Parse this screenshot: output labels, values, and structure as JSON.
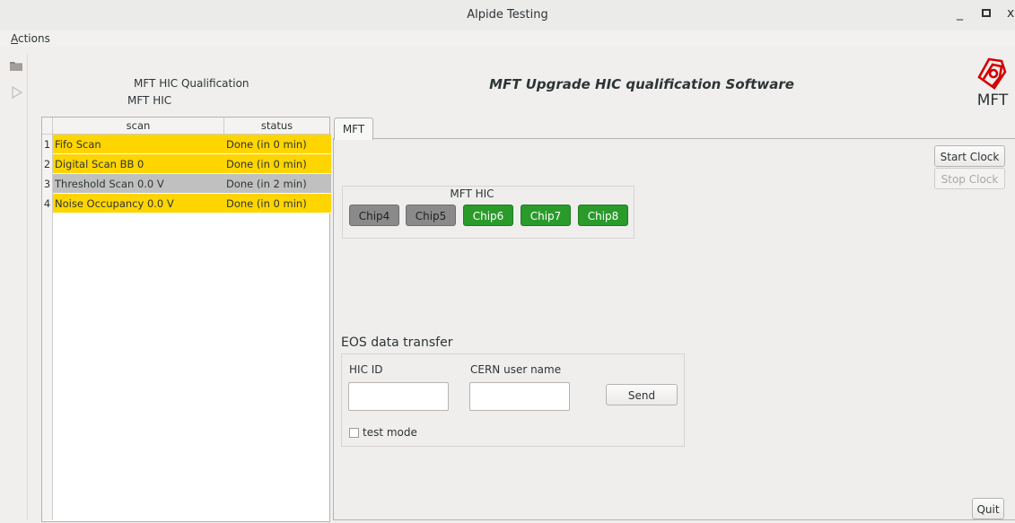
{
  "window": {
    "title": "Alpide Testing",
    "minimize": "_",
    "maximize": "▫",
    "close": "x"
  },
  "menu": {
    "actions_first": "A",
    "actions_rest": "ctions"
  },
  "toolbar": {
    "items": [
      "folder-icon",
      "play-icon"
    ]
  },
  "header": {
    "qualification_label": "MFT HIC Qualification",
    "hic_label": "MFT HIC",
    "software_title": "MFT Upgrade HIC qualification Software",
    "logo_text": "MFT"
  },
  "scan_table": {
    "columns": [
      "scan",
      "status"
    ],
    "rows": [
      {
        "num": "1",
        "scan": "Fifo Scan",
        "status": "Done (in  0 min)",
        "color": "#ffd500"
      },
      {
        "num": "2",
        "scan": "Digital Scan BB 0",
        "status": "Done (in  0 min)",
        "color": "#ffd500"
      },
      {
        "num": "3",
        "scan": "Threshold Scan 0.0 V",
        "status": "Done (in  2 min)",
        "color": "#c0c0c0"
      },
      {
        "num": "4",
        "scan": "Noise Occupancy 0.0 V",
        "status": "Done (in  0 min)",
        "color": "#ffd500"
      }
    ]
  },
  "tabs": {
    "mft": "MFT"
  },
  "clock": {
    "start": "Start Clock",
    "stop": "Stop Clock"
  },
  "hic_group": {
    "title": "MFT HIC",
    "chips": [
      {
        "label": "Chip4",
        "state": "gray"
      },
      {
        "label": "Chip5",
        "state": "gray"
      },
      {
        "label": "Chip6",
        "state": "green"
      },
      {
        "label": "Chip7",
        "state": "green"
      },
      {
        "label": "Chip8",
        "state": "green"
      }
    ]
  },
  "eos": {
    "title": "EOS data transfer",
    "hic_id_label": "HIC ID",
    "hic_id_value": "",
    "cern_user_label": "CERN user name",
    "cern_user_value": "",
    "send": "Send",
    "test_mode": "test mode"
  },
  "footer": {
    "quit": "Quit"
  },
  "colors": {
    "done_yellow": "#ffd500",
    "done_gray": "#c0c0c0",
    "chip_green": "#2a9a2a",
    "chip_gray": "#8a8a8a"
  }
}
